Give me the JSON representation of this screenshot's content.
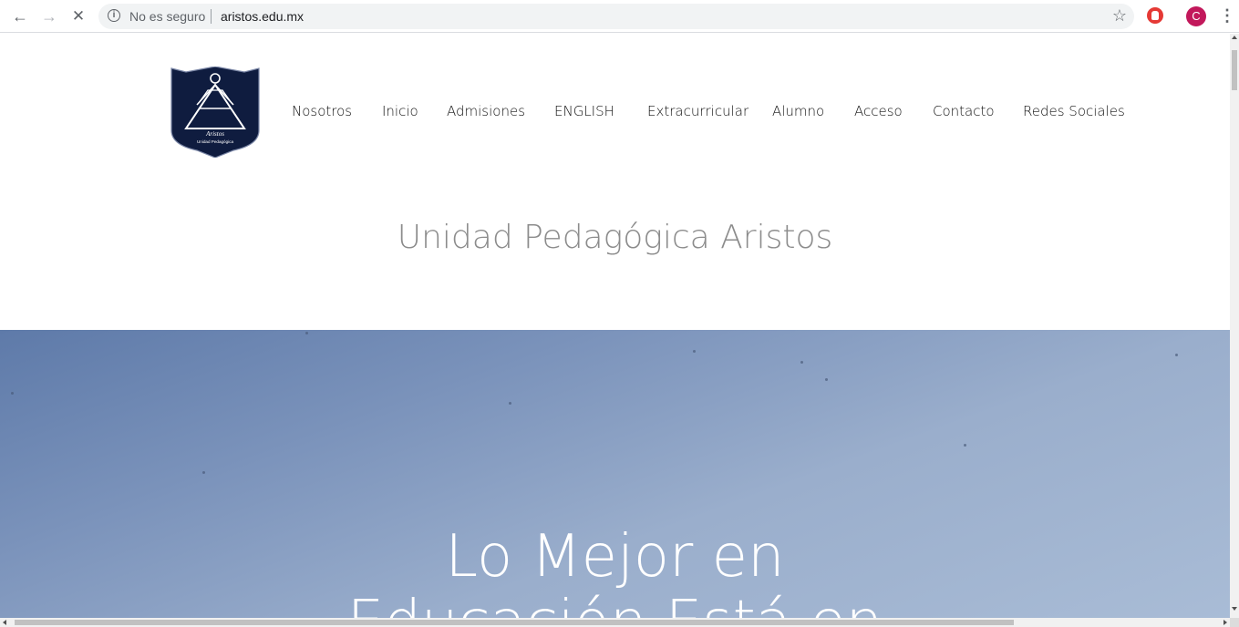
{
  "browser": {
    "back_icon": "←",
    "forward_icon": "→",
    "stop_icon": "✕",
    "security_label": "No es seguro",
    "url": "aristos.edu.mx",
    "bookmark_icon": "☆",
    "avatar_letter": "C",
    "menu_icon": "⋮"
  },
  "site": {
    "logo_text_script": "Aristos",
    "logo_text_sub": "Unidad Pedagógica",
    "nav": [
      "Nosotros",
      "Inicio",
      "Admisiones",
      "ENGLISH",
      "Extracurricular",
      "Alumno",
      "Acceso",
      "Contacto",
      "Redes Sociales"
    ],
    "title": "Unidad Pedagógica Aristos",
    "hero_line1": "Lo Mejor en",
    "hero_line2": "Educación Está en"
  },
  "colors": {
    "logo_bg": "#0f1c3f",
    "avatar_bg": "#c2185b",
    "extension": "#e53935",
    "hero_top": "#5e7aa9",
    "hero_bottom": "#a9bcd6"
  }
}
